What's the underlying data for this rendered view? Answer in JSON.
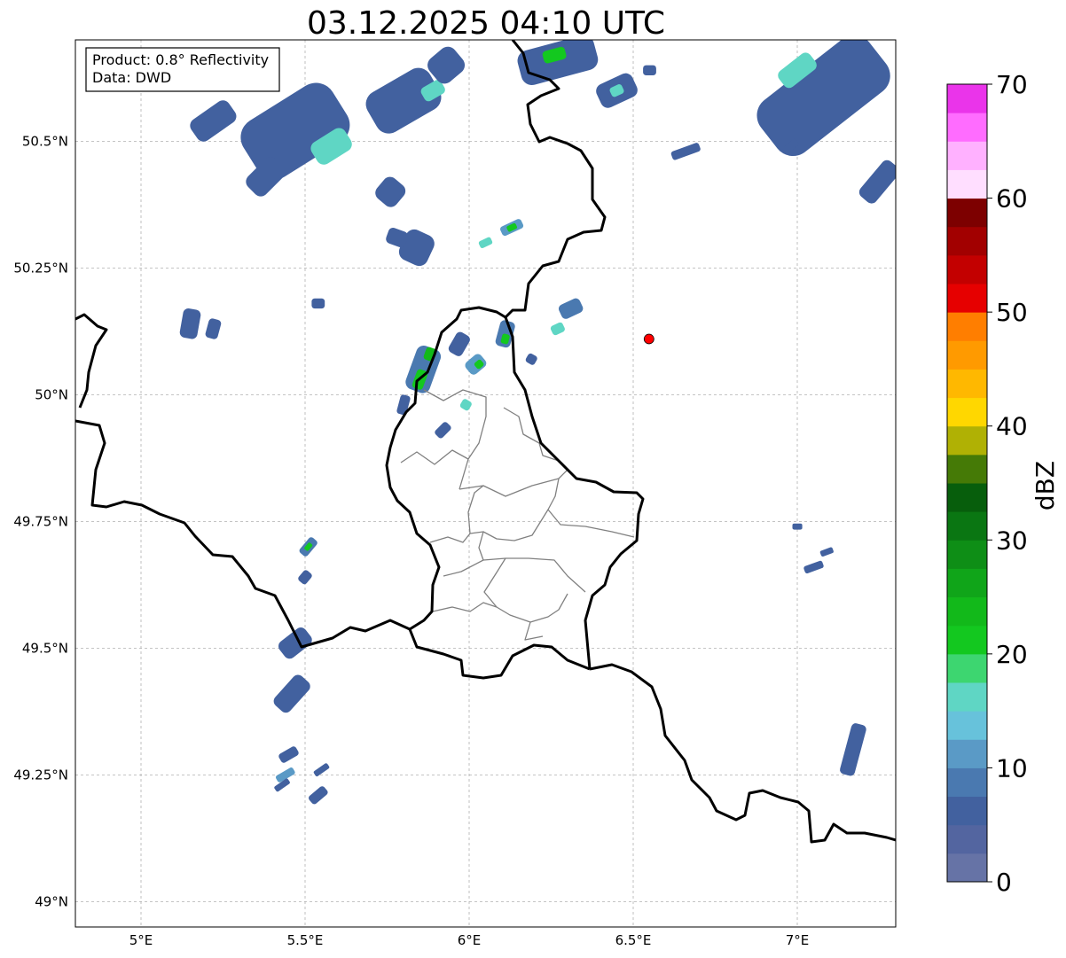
{
  "title": "03.12.2025 04:10 UTC",
  "info_box": {
    "line1": "Product: 0.8° Reflectivity",
    "line2": "Data: DWD"
  },
  "map": {
    "lon_range": [
      4.8,
      7.3
    ],
    "lat_range": [
      48.95,
      50.7
    ],
    "lon_ticks": [
      {
        "value": 5.0,
        "label": "5°E"
      },
      {
        "value": 5.5,
        "label": "5.5°E"
      },
      {
        "value": 6.0,
        "label": "6°E"
      },
      {
        "value": 6.5,
        "label": "6.5°E"
      },
      {
        "value": 7.0,
        "label": "7°E"
      }
    ],
    "lat_ticks": [
      {
        "value": 49.0,
        "label": "49°N"
      },
      {
        "value": 49.25,
        "label": "49.25°N"
      },
      {
        "value": 49.5,
        "label": "49.5°N"
      },
      {
        "value": 49.75,
        "label": "49.75°N"
      },
      {
        "value": 50.0,
        "label": "50°N"
      },
      {
        "value": 50.25,
        "label": "50.25°N"
      },
      {
        "value": 50.5,
        "label": "50.5°N"
      }
    ],
    "gridlines": true,
    "radar_site": {
      "lon": 6.548,
      "lat": 50.11,
      "color": "#ff0000"
    }
  },
  "colorbar": {
    "label": "dBZ",
    "min": 0,
    "max": 70,
    "step": 2.5,
    "tick_values": [
      0,
      10,
      20,
      30,
      40,
      50,
      60,
      70
    ],
    "tick_labels": [
      "0",
      "10",
      "20",
      "30",
      "40",
      "50",
      "60",
      "70"
    ],
    "colors": [
      "#6673a6",
      "#5365a0",
      "#42619f",
      "#4a79b0",
      "#5a9ac6",
      "#67c2db",
      "#5fd6c4",
      "#3dd670",
      "#13c81f",
      "#12b91a",
      "#10a519",
      "#0e8e16",
      "#0a7612",
      "#075e0c",
      "#457a06",
      "#b0b104",
      "#ffd700",
      "#ffb800",
      "#ff9a00",
      "#ff7e00",
      "#e60000",
      "#c30000",
      "#a20000",
      "#7d0000",
      "#ffdeff",
      "#ffb1ff",
      "#ff6cff",
      "#ea34ea"
    ]
  },
  "precip_cells": [
    {
      "lon": 5.47,
      "lat": 50.52,
      "width_deg": 0.32,
      "height_deg": 0.13,
      "angle": -32,
      "dbz": 6
    },
    {
      "lon": 5.58,
      "lat": 50.49,
      "width_deg": 0.12,
      "height_deg": 0.05,
      "angle": -32,
      "dbz": 17
    },
    {
      "lon": 5.8,
      "lat": 50.58,
      "width_deg": 0.22,
      "height_deg": 0.09,
      "angle": -30,
      "dbz": 6
    },
    {
      "lon": 5.89,
      "lat": 50.6,
      "width_deg": 0.07,
      "height_deg": 0.03,
      "angle": -30,
      "dbz": 17
    },
    {
      "lon": 5.93,
      "lat": 50.65,
      "width_deg": 0.1,
      "height_deg": 0.06,
      "angle": -40,
      "dbz": 7
    },
    {
      "lon": 5.22,
      "lat": 50.54,
      "width_deg": 0.14,
      "height_deg": 0.05,
      "angle": -35,
      "dbz": 6
    },
    {
      "lon": 5.38,
      "lat": 50.43,
      "width_deg": 0.12,
      "height_deg": 0.05,
      "angle": -45,
      "dbz": 6
    },
    {
      "lon": 5.76,
      "lat": 50.4,
      "width_deg": 0.08,
      "height_deg": 0.05,
      "angle": -50,
      "dbz": 6
    },
    {
      "lon": 5.84,
      "lat": 50.29,
      "width_deg": 0.1,
      "height_deg": 0.06,
      "angle": -65,
      "dbz": 7
    },
    {
      "lon": 5.78,
      "lat": 50.31,
      "width_deg": 0.05,
      "height_deg": 0.04,
      "angle": -70,
      "dbz": 6
    },
    {
      "lon": 6.13,
      "lat": 50.33,
      "width_deg": 0.07,
      "height_deg": 0.02,
      "angle": -25,
      "dbz": 12
    },
    {
      "lon": 6.13,
      "lat": 50.33,
      "width_deg": 0.03,
      "height_deg": 0.012,
      "angle": -25,
      "dbz": 22
    },
    {
      "lon": 6.05,
      "lat": 50.3,
      "width_deg": 0.04,
      "height_deg": 0.015,
      "angle": -25,
      "dbz": 17
    },
    {
      "lon": 6.27,
      "lat": 50.66,
      "width_deg": 0.24,
      "height_deg": 0.07,
      "angle": -15,
      "dbz": 7
    },
    {
      "lon": 6.26,
      "lat": 50.67,
      "width_deg": 0.07,
      "height_deg": 0.025,
      "angle": -15,
      "dbz": 22
    },
    {
      "lon": 6.45,
      "lat": 50.6,
      "width_deg": 0.12,
      "height_deg": 0.05,
      "angle": -25,
      "dbz": 7
    },
    {
      "lon": 6.45,
      "lat": 50.6,
      "width_deg": 0.04,
      "height_deg": 0.02,
      "angle": -25,
      "dbz": 17
    },
    {
      "lon": 6.55,
      "lat": 50.64,
      "width_deg": 0.04,
      "height_deg": 0.02,
      "angle": 0,
      "dbz": 6
    },
    {
      "lon": 6.66,
      "lat": 50.48,
      "width_deg": 0.09,
      "height_deg": 0.018,
      "angle": -20,
      "dbz": 6
    },
    {
      "lon": 7.08,
      "lat": 50.59,
      "width_deg": 0.42,
      "height_deg": 0.13,
      "angle": -38,
      "dbz": 7
    },
    {
      "lon": 7.0,
      "lat": 50.64,
      "width_deg": 0.12,
      "height_deg": 0.04,
      "angle": -38,
      "dbz": 16
    },
    {
      "lon": 7.25,
      "lat": 50.42,
      "width_deg": 0.14,
      "height_deg": 0.04,
      "angle": -50,
      "dbz": 6
    },
    {
      "lon": 6.98,
      "lat": 50.49,
      "width_deg": 0.05,
      "height_deg": 0.015,
      "angle": -40,
      "dbz": 6
    },
    {
      "lon": 5.15,
      "lat": 50.14,
      "width_deg": 0.09,
      "height_deg": 0.035,
      "angle": -80,
      "dbz": 6
    },
    {
      "lon": 5.22,
      "lat": 50.13,
      "width_deg": 0.06,
      "height_deg": 0.025,
      "angle": -75,
      "dbz": 6
    },
    {
      "lon": 5.54,
      "lat": 50.18,
      "width_deg": 0.04,
      "height_deg": 0.02,
      "angle": 0,
      "dbz": 6
    },
    {
      "lon": 5.86,
      "lat": 50.05,
      "width_deg": 0.14,
      "height_deg": 0.05,
      "angle": -70,
      "dbz": 8
    },
    {
      "lon": 5.85,
      "lat": 50.03,
      "width_deg": 0.06,
      "height_deg": 0.022,
      "angle": -70,
      "dbz": 20
    },
    {
      "lon": 5.88,
      "lat": 50.08,
      "width_deg": 0.04,
      "height_deg": 0.02,
      "angle": -70,
      "dbz": 24
    },
    {
      "lon": 5.8,
      "lat": 49.98,
      "width_deg": 0.06,
      "height_deg": 0.02,
      "angle": -75,
      "dbz": 7
    },
    {
      "lon": 5.92,
      "lat": 49.93,
      "width_deg": 0.05,
      "height_deg": 0.02,
      "angle": -45,
      "dbz": 6
    },
    {
      "lon": 5.97,
      "lat": 50.1,
      "width_deg": 0.07,
      "height_deg": 0.03,
      "angle": -60,
      "dbz": 7
    },
    {
      "lon": 6.02,
      "lat": 50.06,
      "width_deg": 0.06,
      "height_deg": 0.03,
      "angle": -40,
      "dbz": 10
    },
    {
      "lon": 6.03,
      "lat": 50.06,
      "width_deg": 0.025,
      "height_deg": 0.015,
      "angle": -40,
      "dbz": 21
    },
    {
      "lon": 5.99,
      "lat": 49.98,
      "width_deg": 0.03,
      "height_deg": 0.02,
      "angle": -60,
      "dbz": 17
    },
    {
      "lon": 6.11,
      "lat": 50.12,
      "width_deg": 0.08,
      "height_deg": 0.03,
      "angle": -75,
      "dbz": 9
    },
    {
      "lon": 6.11,
      "lat": 50.11,
      "width_deg": 0.03,
      "height_deg": 0.015,
      "angle": -75,
      "dbz": 22
    },
    {
      "lon": 6.19,
      "lat": 50.07,
      "width_deg": 0.03,
      "height_deg": 0.02,
      "angle": -60,
      "dbz": 6
    },
    {
      "lon": 6.31,
      "lat": 50.17,
      "width_deg": 0.07,
      "height_deg": 0.03,
      "angle": -25,
      "dbz": 9
    },
    {
      "lon": 6.27,
      "lat": 50.13,
      "width_deg": 0.04,
      "height_deg": 0.02,
      "angle": -25,
      "dbz": 15
    },
    {
      "lon": 5.51,
      "lat": 49.7,
      "width_deg": 0.06,
      "height_deg": 0.02,
      "angle": -50,
      "dbz": 9
    },
    {
      "lon": 5.51,
      "lat": 49.7,
      "width_deg": 0.025,
      "height_deg": 0.01,
      "angle": -50,
      "dbz": 21
    },
    {
      "lon": 5.5,
      "lat": 49.64,
      "width_deg": 0.04,
      "height_deg": 0.02,
      "angle": -50,
      "dbz": 6
    },
    {
      "lon": 5.47,
      "lat": 49.51,
      "width_deg": 0.1,
      "height_deg": 0.04,
      "angle": -38,
      "dbz": 6
    },
    {
      "lon": 5.46,
      "lat": 49.41,
      "width_deg": 0.12,
      "height_deg": 0.04,
      "angle": -48,
      "dbz": 6
    },
    {
      "lon": 5.45,
      "lat": 49.29,
      "width_deg": 0.06,
      "height_deg": 0.02,
      "angle": -30,
      "dbz": 7
    },
    {
      "lon": 5.44,
      "lat": 49.25,
      "width_deg": 0.06,
      "height_deg": 0.015,
      "angle": -30,
      "dbz": 12
    },
    {
      "lon": 5.54,
      "lat": 49.21,
      "width_deg": 0.06,
      "height_deg": 0.02,
      "angle": -40,
      "dbz": 6
    },
    {
      "lon": 5.55,
      "lat": 49.26,
      "width_deg": 0.05,
      "height_deg": 0.012,
      "angle": -35,
      "dbz": 6
    },
    {
      "lon": 5.43,
      "lat": 49.23,
      "width_deg": 0.05,
      "height_deg": 0.012,
      "angle": -35,
      "dbz": 6
    },
    {
      "lon": 7.17,
      "lat": 49.3,
      "width_deg": 0.16,
      "height_deg": 0.03,
      "angle": -75,
      "dbz": 6
    },
    {
      "lon": 7.05,
      "lat": 49.66,
      "width_deg": 0.06,
      "height_deg": 0.015,
      "angle": -20,
      "dbz": 6
    },
    {
      "lon": 7.09,
      "lat": 49.69,
      "width_deg": 0.04,
      "height_deg": 0.012,
      "angle": -20,
      "dbz": 6
    },
    {
      "lon": 7.0,
      "lat": 49.74,
      "width_deg": 0.03,
      "height_deg": 0.012,
      "angle": 0,
      "dbz": 6
    }
  ]
}
